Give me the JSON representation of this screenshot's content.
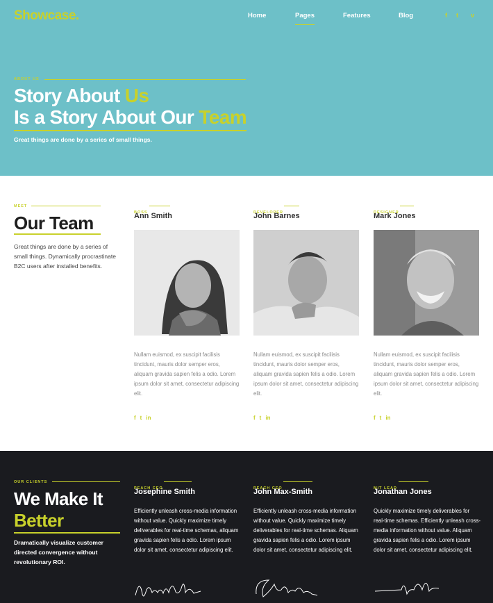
{
  "header": {
    "logo": "Showcase.",
    "nav": [
      {
        "label": "Home"
      },
      {
        "label": "Pages"
      },
      {
        "label": "Features"
      },
      {
        "label": "Blog"
      }
    ],
    "social": [
      "f",
      "t",
      "v"
    ]
  },
  "hero": {
    "kicker": "ABOUT US",
    "title_line1_a": "Story About ",
    "title_line1_b": "Us",
    "title_line2_a": "Is a Story About Our ",
    "title_line2_b": "Team",
    "subtitle": "Great things are done by a series of small things."
  },
  "team": {
    "kicker": "MEET",
    "title": "Our Team",
    "description": "Great things are done by a series of small things. Dynamically procrastinate B2C users after installed benefits.",
    "members": [
      {
        "role": "BOSS",
        "name": "Ann Smith",
        "bio": "Nullam euismod, ex suscipit facilisis tincidunt, mauris dolor semper eros, aliquam gravida sapien felis a odio. Lorem ipsum dolor sit amet, consectetur adipiscing elit."
      },
      {
        "role": "DEVELOPER",
        "name": "John Barnes",
        "bio": "Nullam euismod, ex suscipit facilisis tincidunt, mauris dolor semper eros, aliquam gravida sapien felis a odio. Lorem ipsum dolor sit amet, consectetur adipiscing elit."
      },
      {
        "role": "DESIGNER",
        "name": "Mark Jones",
        "bio": "Nullam euismod, ex suscipit facilisis tincidunt, mauris dolor semper eros, aliquam gravida sapien felis a odio. Lorem ipsum dolor sit amet, consectetur adipiscing elit."
      }
    ],
    "member_social": [
      "f",
      "t",
      "in"
    ]
  },
  "clients": {
    "kicker": "OUR CLIENTS",
    "title_a": "We Make It",
    "title_b": "Better",
    "description": "Dramatically visualize customer directed convergence without revolutionary ROI.",
    "items": [
      {
        "role": "PEACH CEO",
        "name": "Josephine Smith",
        "quote": "Efficiently unleash cross-media information without value. Quickly maximize timely deliverables for real-time schemas, aliquam gravida sapien felis a odio. Lorem ipsum dolor sit amet, consectetur adipiscing elit."
      },
      {
        "role": "PEACH CEO",
        "name": "John Max-Smith",
        "quote": "Efficiently unleash cross-media information without value. Quickly maximize timely deliverables for real-time schemas. Aliquam gravida sapien felis a odio. Lorem ipsum dolor sit amet, consectetur adipiscing elit."
      },
      {
        "role": "MIT LEAD",
        "name": "Jonathan Jones",
        "quote": "Quickly maximize timely deliverables for real-time schemas. Efficiently unleash cross-media information without value. Aliquam gravida sapien felis a odio. Lorem ipsum dolor sit amet, consectetur adipiscing elit."
      }
    ]
  },
  "colors": {
    "hero_bg": "#6dc0c8",
    "accent": "#c8d12b",
    "dark_bg": "#1a1b1f"
  }
}
